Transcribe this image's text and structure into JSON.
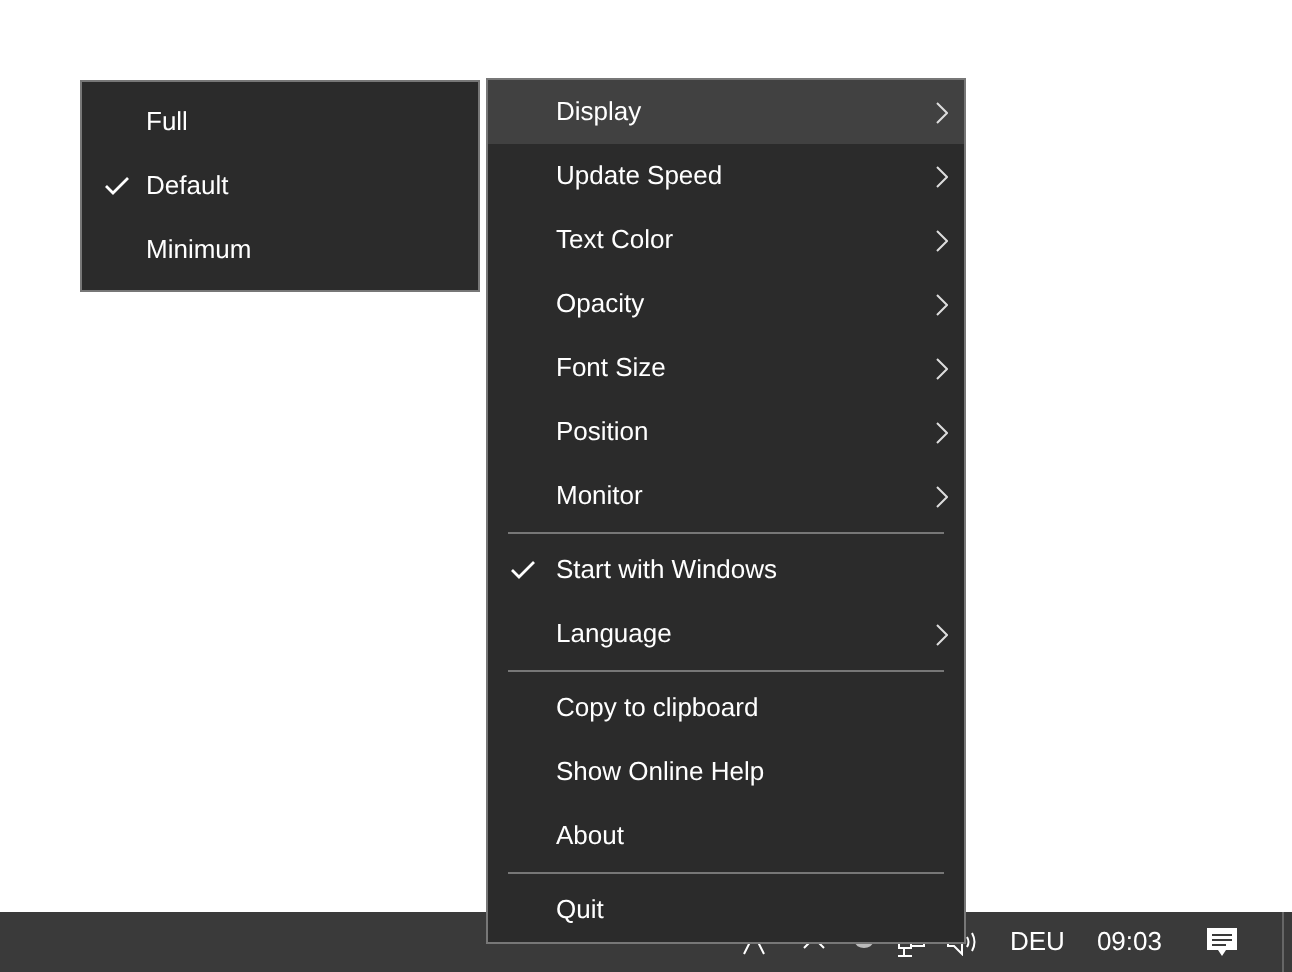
{
  "main_menu": {
    "items": [
      {
        "kind": "submenu",
        "label": "Display",
        "selected": true,
        "checked": false
      },
      {
        "kind": "submenu",
        "label": "Update Speed",
        "selected": false,
        "checked": false
      },
      {
        "kind": "submenu",
        "label": "Text Color",
        "selected": false,
        "checked": false
      },
      {
        "kind": "submenu",
        "label": "Opacity",
        "selected": false,
        "checked": false
      },
      {
        "kind": "submenu",
        "label": "Font Size",
        "selected": false,
        "checked": false
      },
      {
        "kind": "submenu",
        "label": "Position",
        "selected": false,
        "checked": false
      },
      {
        "kind": "submenu",
        "label": "Monitor",
        "selected": false,
        "checked": false
      },
      {
        "kind": "separator"
      },
      {
        "kind": "item",
        "label": "Start with Windows",
        "selected": false,
        "checked": true
      },
      {
        "kind": "submenu",
        "label": "Language",
        "selected": false,
        "checked": false
      },
      {
        "kind": "separator"
      },
      {
        "kind": "item",
        "label": "Copy to clipboard",
        "selected": false,
        "checked": false
      },
      {
        "kind": "item",
        "label": "Show Online Help",
        "selected": false,
        "checked": false
      },
      {
        "kind": "item",
        "label": "About",
        "selected": false,
        "checked": false
      },
      {
        "kind": "separator"
      },
      {
        "kind": "item",
        "label": "Quit",
        "selected": false,
        "checked": false
      }
    ]
  },
  "display_submenu": {
    "items": [
      {
        "label": "Full",
        "checked": false
      },
      {
        "label": "Default",
        "checked": true
      },
      {
        "label": "Minimum",
        "checked": false
      }
    ]
  },
  "taskbar": {
    "language": "DEU",
    "time": "09:03"
  }
}
